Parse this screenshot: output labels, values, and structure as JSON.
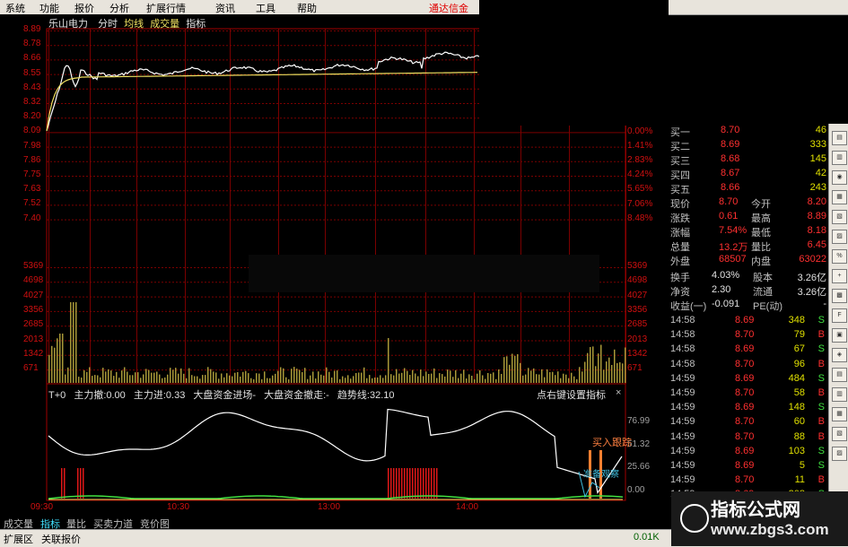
{
  "menu": [
    "系统",
    "功能",
    "报价",
    "分析",
    "扩展行情",
    "资讯",
    "工具",
    "帮助"
  ],
  "brand": "通达信金",
  "chart_title": {
    "name": "乐山电力",
    "mode": "分时",
    "avg": "均线",
    "vol": "成交量",
    "ind": "指标"
  },
  "price_axis_left": [
    "8.89",
    "8.78",
    "8.66",
    "8.55",
    "8.43",
    "8.32",
    "8.20",
    "8.09",
    "7.98",
    "7.86",
    "7.75",
    "7.63",
    "7.52",
    "7.40"
  ],
  "price_axis_right": [
    "1.41%",
    "0.00%",
    "1.41%",
    "2.83%",
    "4.24%",
    "5.65%",
    "7.06%",
    "8.48%"
  ],
  "vol_axis": [
    "5369",
    "4698",
    "4027",
    "3356",
    "2685",
    "2013",
    "1342",
    "671"
  ],
  "indicator_header": {
    "t0": "T+0",
    "a": "主力撤:0.00",
    "b": "主力进:0.33",
    "c": "大盘资金进场-",
    "d": "大盘资金撤走:-",
    "e": "趋势线:32.10",
    "hint": "点右键设置指标",
    "close": "×"
  },
  "ind_axis": [
    "76.99",
    "51.32",
    "25.66",
    "0.00"
  ],
  "annot_buy": "买入跟踪",
  "annot_ready": "准备观察",
  "time_axis": [
    "09:30",
    "10:30",
    "13:00",
    "14:00"
  ],
  "orderbook": [
    {
      "label": "买一",
      "price": "8.70",
      "vol": "46"
    },
    {
      "label": "买二",
      "price": "8.69",
      "vol": "333"
    },
    {
      "label": "买三",
      "price": "8.68",
      "vol": "145"
    },
    {
      "label": "买四",
      "price": "8.67",
      "vol": "42"
    },
    {
      "label": "买五",
      "price": "8.66",
      "vol": "243"
    }
  ],
  "quote": [
    {
      "l1": "现价",
      "v1": "8.70",
      "l2": "今开",
      "v2": "8.20"
    },
    {
      "l1": "涨跌",
      "v1": "0.61",
      "l2": "最高",
      "v2": "8.89"
    },
    {
      "l1": "涨幅",
      "v1": "7.54%",
      "l2": "最低",
      "v2": "8.18"
    },
    {
      "l1": "总量",
      "v1": "13.2万",
      "l2": "量比",
      "v2": "6.45"
    },
    {
      "l1": "外盘",
      "v1": "68507",
      "l2": "内盘",
      "v2": "63022"
    }
  ],
  "fund": [
    {
      "l1": "换手",
      "v1": "4.03%",
      "l2": "股本",
      "v2": "3.26亿"
    },
    {
      "l1": "净资",
      "v1": "2.30",
      "l2": "流通",
      "v2": "3.26亿"
    },
    {
      "l1": "收益(一)",
      "v1": "-0.091",
      "l2": "PE(动)",
      "v2": "-"
    }
  ],
  "ticks": [
    {
      "t": "14:58",
      "p": "8.69",
      "v": "348",
      "s": "S"
    },
    {
      "t": "14:58",
      "p": "8.70",
      "v": "79",
      "s": "B"
    },
    {
      "t": "14:58",
      "p": "8.69",
      "v": "67",
      "s": "S"
    },
    {
      "t": "14:58",
      "p": "8.70",
      "v": "96",
      "s": "B"
    },
    {
      "t": "14:59",
      "p": "8.69",
      "v": "484",
      "s": "S"
    },
    {
      "t": "14:59",
      "p": "8.70",
      "v": "58",
      "s": "B"
    },
    {
      "t": "14:59",
      "p": "8.69",
      "v": "148",
      "s": "S"
    },
    {
      "t": "14:59",
      "p": "8.70",
      "v": "60",
      "s": "B"
    },
    {
      "t": "14:59",
      "p": "8.70",
      "v": "88",
      "s": "B"
    },
    {
      "t": "14:59",
      "p": "8.69",
      "v": "103",
      "s": "S"
    },
    {
      "t": "14:59",
      "p": "8.69",
      "v": "5",
      "s": "S"
    },
    {
      "t": "14:59",
      "p": "8.70",
      "v": "11",
      "s": "B"
    },
    {
      "t": "14:59",
      "p": "8.69",
      "v": "208",
      "s": "S"
    }
  ],
  "bottom_tabs": [
    "成交量",
    "指标",
    "量比",
    "买卖力道",
    "竞价图"
  ],
  "status": {
    "ext": "扩展区",
    "rel": "关联报价",
    "net": "0.01K"
  },
  "watermark": {
    "title": "指标公式网",
    "url": "www.zbgs3.com"
  },
  "colors": {
    "up": "#ff3030",
    "down": "#40e040",
    "price": "#ffffff",
    "avg": "#f0e060",
    "vol": "#b0a040",
    "grid": "#8b0000"
  }
}
